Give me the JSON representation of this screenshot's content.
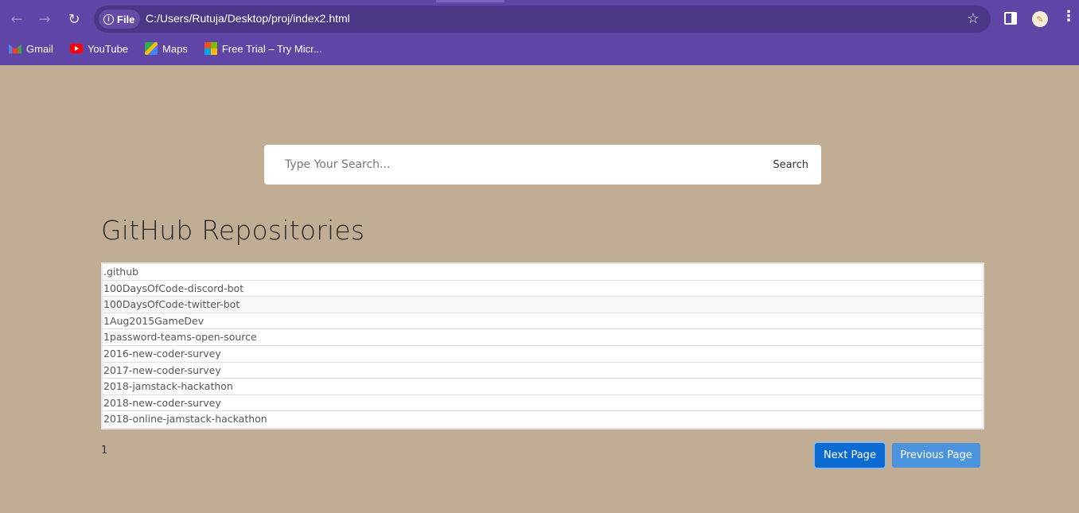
{
  "browser": {
    "file_chip": "File",
    "url": "C:/Users/Rutuja/Desktop/proj/index2.html",
    "bookmarks": [
      {
        "label": "Gmail",
        "icon": "gmail-icon"
      },
      {
        "label": "YouTube",
        "icon": "youtube-icon"
      },
      {
        "label": "Maps",
        "icon": "maps-icon"
      },
      {
        "label": "Free Trial – Try Micr...",
        "icon": "microsoft-icon"
      }
    ]
  },
  "search": {
    "placeholder": "Type Your Search...",
    "button_label": "Search"
  },
  "main": {
    "title": "GitHub Repositories",
    "repositories": [
      ".github",
      "100DaysOfCode-discord-bot",
      "100DaysOfCode-twitter-bot",
      "1Aug2015GameDev",
      "1password-teams-open-source",
      "2016-new-coder-survey",
      "2017-new-coder-survey",
      "2018-jamstack-hackathon",
      "2018-new-coder-survey",
      "2018-online-jamstack-hackathon"
    ],
    "page_number": "1",
    "next_label": "Next Page",
    "prev_label": "Previous Page"
  },
  "colors": {
    "page_background": "#c1ad93",
    "browser_chrome": "#5e45a6",
    "next_button": "#0b6bd0",
    "prev_button": "#4b93dd"
  }
}
